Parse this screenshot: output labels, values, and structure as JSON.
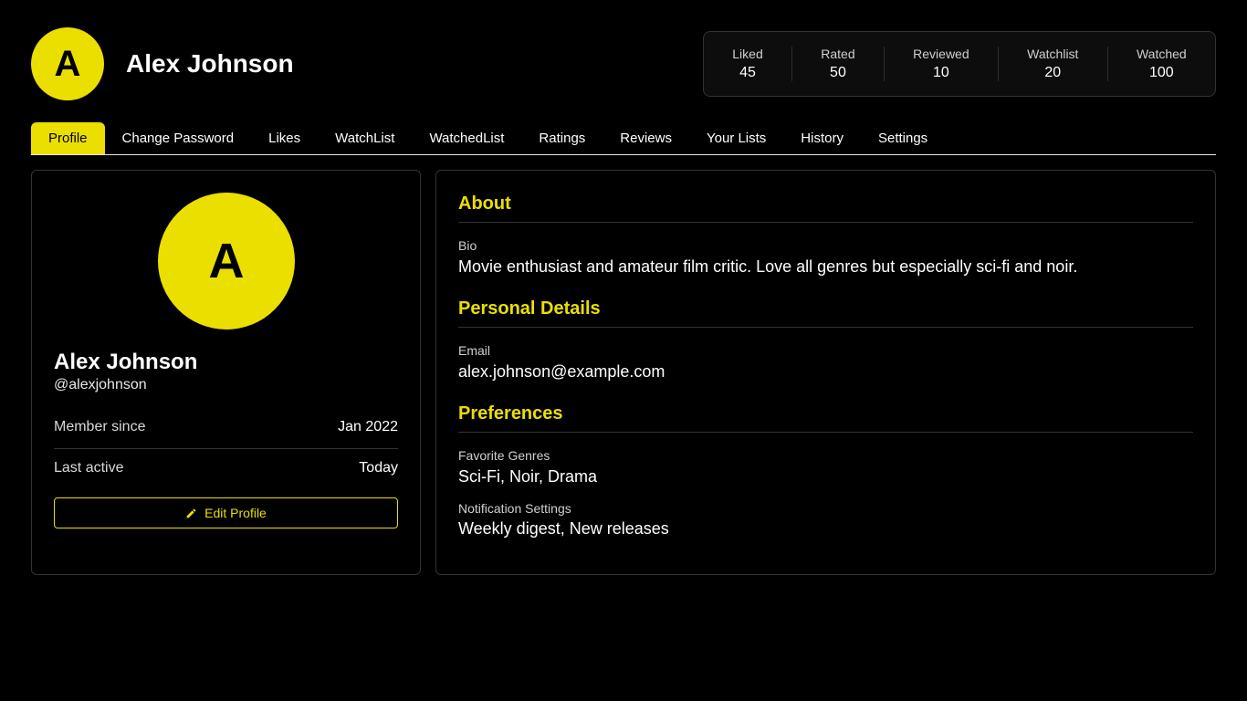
{
  "header": {
    "avatar_initial": "A",
    "name": "Alex Johnson"
  },
  "stats": [
    {
      "label": "Liked",
      "value": "45"
    },
    {
      "label": "Rated",
      "value": "50"
    },
    {
      "label": "Reviewed",
      "value": "10"
    },
    {
      "label": "Watchlist",
      "value": "20"
    },
    {
      "label": "Watched",
      "value": "100"
    }
  ],
  "tabs": [
    {
      "label": "Profile",
      "active": true
    },
    {
      "label": "Change Password"
    },
    {
      "label": "Likes"
    },
    {
      "label": "WatchList"
    },
    {
      "label": "WatchedList"
    },
    {
      "label": "Ratings"
    },
    {
      "label": "Reviews"
    },
    {
      "label": "Your Lists"
    },
    {
      "label": "History"
    },
    {
      "label": "Settings"
    }
  ],
  "profile_card": {
    "avatar_initial": "A",
    "name": "Alex Johnson",
    "handle": "@alexjohnson",
    "member_since_label": "Member since",
    "member_since_value": "Jan 2022",
    "last_active_label": "Last active",
    "last_active_value": "Today",
    "edit_button_label": "Edit Profile",
    "edit_icon": "pencil-icon"
  },
  "details": {
    "about_title": "About",
    "bio_label": "Bio",
    "bio_value": "Movie enthusiast and amateur film critic. Love all genres but especially sci-fi and noir.",
    "personal_title": "Personal Details",
    "email_label": "Email",
    "email_value": "alex.johnson@example.com",
    "preferences_title": "Preferences",
    "genres_label": "Favorite Genres",
    "genres_value": "Sci-Fi, Noir, Drama",
    "notifications_label": "Notification Settings",
    "notifications_value": "Weekly digest, New releases"
  },
  "colors": {
    "accent": "#ebdf00",
    "background": "#000000",
    "border": "#333333"
  }
}
